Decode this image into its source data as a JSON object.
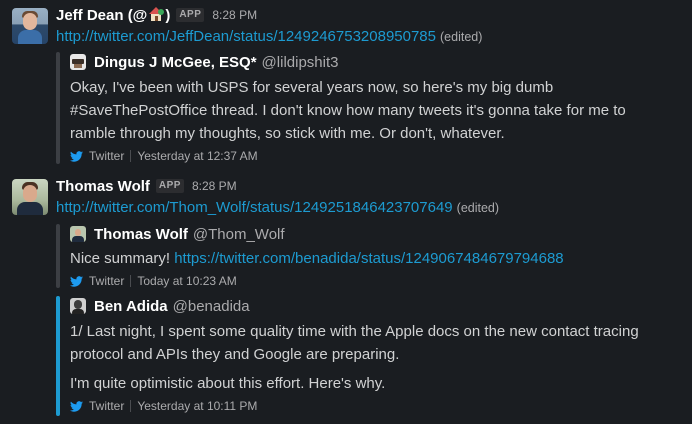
{
  "messages": [
    {
      "author": "Jeff Dean (@",
      "author_suffix": ")",
      "badge": "APP",
      "time": "8:28 PM",
      "link": "http://twitter.com/JeffDean/status/1249246753208950785",
      "edited": "(edited)",
      "attachment": {
        "name": "Dingus J McGee, ESQ*",
        "handle": "@lildipshit3",
        "lines": [
          "Okay, I've been with USPS for several years now, so here's my big dumb",
          "#SaveThePostOffice thread. I don't know how many tweets it's gonna take for me to",
          "ramble through my thoughts, so stick with me. Or don't, whatever."
        ],
        "source": "Twitter",
        "source_time": "Yesterday at 12:37 AM"
      }
    },
    {
      "author": "Thomas Wolf",
      "badge": "APP",
      "time": "8:28 PM",
      "link": "http://twitter.com/Thom_Wolf/status/1249251846423707649",
      "edited": "(edited)",
      "attachment": {
        "name": "Thomas Wolf",
        "handle": "@Thom_Wolf",
        "text_prefix": "Nice summary! ",
        "text_link": "https://twitter.com/benadida/status/1249067484679794688",
        "source": "Twitter",
        "source_time": "Today at 10:23 AM"
      },
      "quoted": {
        "name": "Ben Adida",
        "handle": "@benadida",
        "lines": [
          "1/ Last night, I spent some quality time with the Apple docs on the new contact tracing",
          "protocol and APIs they and Google are preparing."
        ],
        "line2": "I'm quite optimistic about this effort. Here's why.",
        "source": "Twitter",
        "source_time": "Yesterday at 10:11 PM"
      }
    }
  ],
  "colors": {
    "background": "#1a1d21",
    "link": "#1d9bd1",
    "text": "#d1d2d3",
    "muted": "#ababad",
    "quote_bar": "#3c3f44",
    "quote_bar_active": "#1d9bd1"
  },
  "icons": [
    "house-with-garden-emoji",
    "twitter-bird-icon"
  ]
}
